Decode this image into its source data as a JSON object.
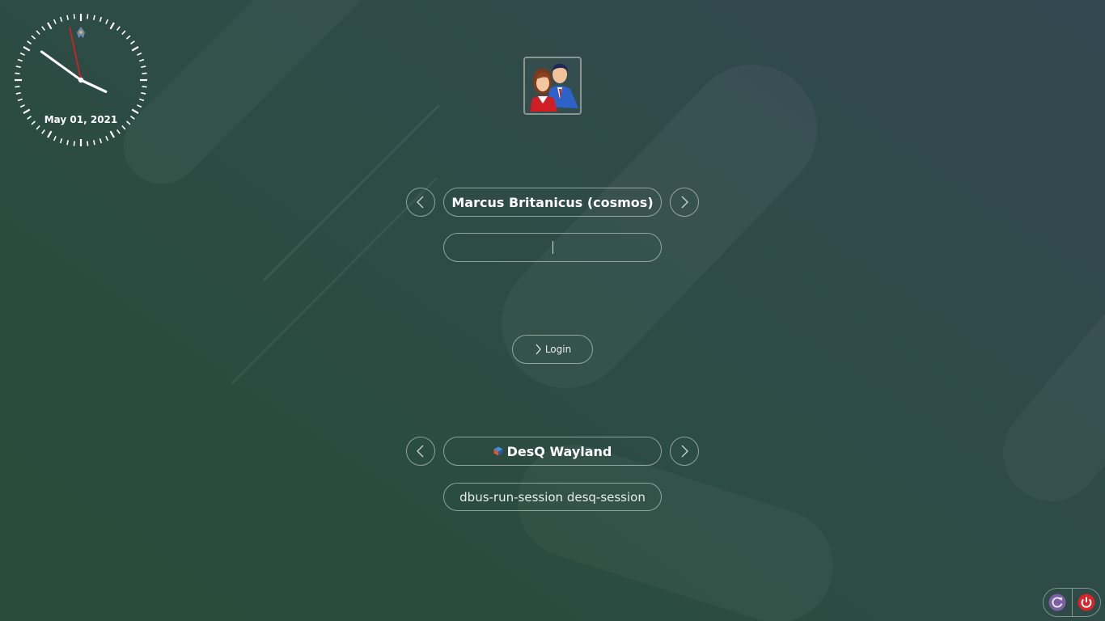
{
  "clock": {
    "date": "May 01, 2021",
    "time_shown": "03:50:58"
  },
  "user": {
    "display_name": "Marcus Britanicus (cosmos)",
    "avatar_icon": "users-icon",
    "previous_icon": "chevron-left-icon",
    "next_icon": "chevron-right-icon"
  },
  "password": {
    "value": "",
    "placeholder": ""
  },
  "login": {
    "label": "Login",
    "icon": "chevron-right-icon"
  },
  "session": {
    "name": "DesQ Wayland",
    "icon": "desq-logo-icon",
    "command": "dbus-run-session desq-session"
  },
  "power": {
    "restart_icon": "restart-icon",
    "shutdown_icon": "power-icon",
    "restart_color": "#7d5fa3",
    "shutdown_color": "#d6262b"
  },
  "theme": {
    "text_color": "#ffffff",
    "border_color": "#9aa8a2"
  }
}
